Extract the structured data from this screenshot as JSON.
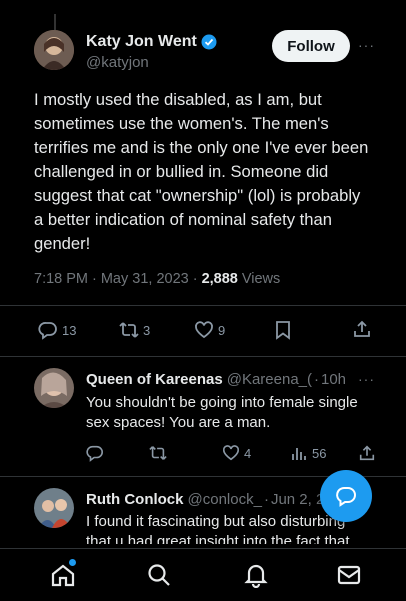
{
  "tweet": {
    "author_name": "Katy Jon Went",
    "author_handle": "@katyjon",
    "follow_label": "Follow",
    "more": "···",
    "text": "I mostly used the disabled, as I am, but sometimes use the women's. The men's terrifies me and is the only one I've ever been challenged in or bullied in. Someone did suggest that cat \"ownership\" (lol) is probably a better indication of nominal safety than gender!",
    "time": "7:18 PM",
    "date": "May 31, 2023",
    "sep1": "·",
    "sep2": "·",
    "views_count": "2,888",
    "views_label": "Views",
    "replies": "13",
    "retweets": "3",
    "likes": "9"
  },
  "replies": [
    {
      "name": "Queen of Kareenas",
      "handle": "@Kareena_(",
      "sep": "·",
      "time": "10h",
      "more": "···",
      "text": "You shouldn't be going into female single sex spaces! You are a man.",
      "likes": "4",
      "views": "56"
    },
    {
      "name": "Ruth Conlock",
      "handle": "@conlock_",
      "sep": "·",
      "time": "Jun 2, 2",
      "text": "I found it fascinating but also disturbing that u had great insight into the fact that"
    }
  ],
  "colors": {
    "background": "#000000",
    "text": "#e7e9ea",
    "muted": "#71767b",
    "accent": "#1d9bf0"
  },
  "icons": {
    "bottom_nav": [
      "home-icon",
      "search-icon",
      "notifications-icon",
      "messages-icon"
    ],
    "fab": "compose-reply-icon"
  }
}
